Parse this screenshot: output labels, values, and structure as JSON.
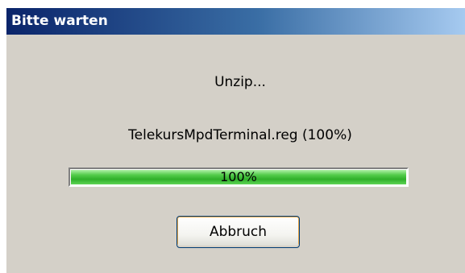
{
  "window": {
    "title": "Bitte warten"
  },
  "content": {
    "status_text": "Unzip...",
    "file_text": "TelekursMpdTerminal.reg (100%)"
  },
  "progress": {
    "value_percent": 100,
    "label": "100%"
  },
  "buttons": {
    "cancel_label": "Abbruch"
  },
  "colors": {
    "titlebar_start": "#0a246a",
    "titlebar_end": "#a6caf0",
    "dialog_background": "#d4d0c8",
    "progress_fill": "#2fb02a"
  }
}
